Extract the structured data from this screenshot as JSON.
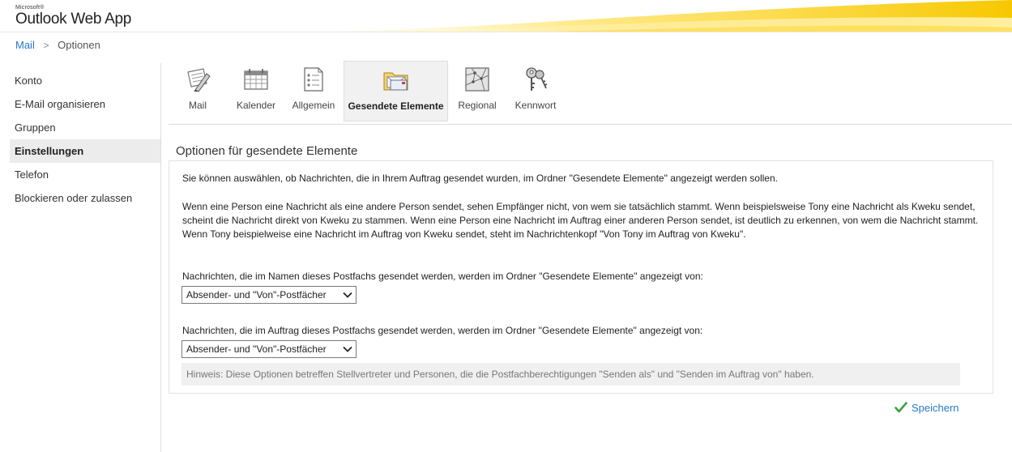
{
  "header": {
    "brand_small": "Microsoft®",
    "brand_name": "Outlook Web App"
  },
  "breadcrumb": {
    "root": "Mail",
    "separator": ">",
    "current": "Optionen"
  },
  "sidebar": {
    "items": [
      {
        "label": "Konto"
      },
      {
        "label": "E-Mail organisieren"
      },
      {
        "label": "Gruppen"
      },
      {
        "label": "Einstellungen"
      },
      {
        "label": "Telefon"
      },
      {
        "label": "Blockieren oder zulassen"
      }
    ],
    "active": "Einstellungen"
  },
  "toolbar": {
    "items": [
      {
        "label": "Mail",
        "icon": "mail-settings-icon"
      },
      {
        "label": "Kalender",
        "icon": "calendar-icon"
      },
      {
        "label": "Allgemein",
        "icon": "general-list-icon"
      },
      {
        "label": "Gesendete Elemente",
        "icon": "sent-items-folder-icon"
      },
      {
        "label": "Regional",
        "icon": "regional-map-icon"
      },
      {
        "label": "Kennwort",
        "icon": "keys-icon"
      }
    ],
    "active": "Gesendete Elemente"
  },
  "content": {
    "title": "Optionen für gesendete Elemente",
    "intro": "Sie können auswählen, ob Nachrichten, die in Ihrem Auftrag gesendet wurden, im Ordner \"Gesendete Elemente\" angezeigt werden sollen.",
    "explanation": "Wenn eine Person eine Nachricht als eine andere Person sendet, sehen Empfänger nicht, von wem sie tatsächlich stammt. Wenn beispielsweise Tony eine Nachricht als Kweku sendet, scheint die Nachricht direkt von Kweku zu stammen. Wenn eine Person eine Nachricht im Auftrag einer anderen Person sendet, ist deutlich zu erkennen, von wem die Nachricht stammt. Wenn Tony beispielweise eine Nachricht im Auftrag von Kweku sendet, steht im Nachrichtenkopf \"Von Tony im Auftrag von Kweku\".",
    "send_as_label": "Nachrichten, die im Namen dieses Postfachs gesendet werden, werden im Ordner \"Gesendete Elemente\" angezeigt von:",
    "send_as_value": "Absender- und \"Von\"-Postfächer",
    "send_on_behalf_label": "Nachrichten, die im Auftrag dieses Postfachs gesendet werden, werden im Ordner \"Gesendete Elemente\" angezeigt von:",
    "send_on_behalf_value": "Absender- und \"Von\"-Postfächer",
    "hint": "Hinweis: Diese Optionen betreffen Stellvertreter und Personen, die die Postfachberechtigungen \"Senden als\" und \"Senden im Auftrag von\" haben."
  },
  "actions": {
    "save_label": "Speichern"
  },
  "colors": {
    "link": "#2878c8",
    "check": "#3fa33f",
    "swoosh": "#f7c800"
  }
}
